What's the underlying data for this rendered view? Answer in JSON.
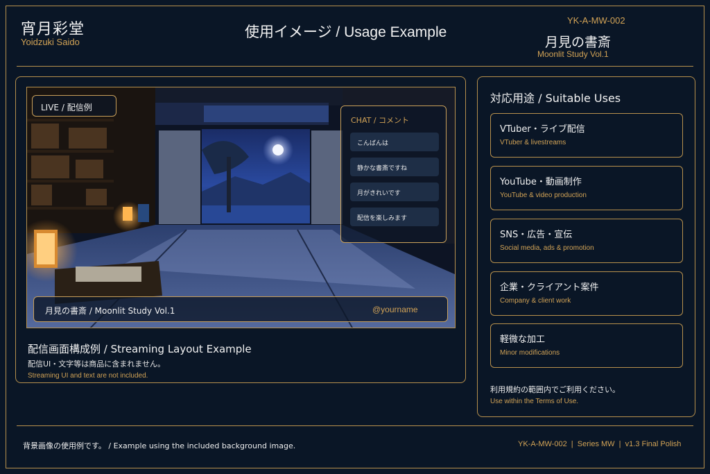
{
  "header": {
    "brand_jp": "宵月彩堂",
    "brand_en": "Yoidzuki Saido",
    "title": "使用イメージ / Usage Example",
    "product_code": "YK-A-MW-002",
    "product_jp": "月見の書斎",
    "product_en": "Moonlit Study Vol.1"
  },
  "preview": {
    "live_tag": "LIVE / 配信例",
    "chat": {
      "title": "CHAT / コメント",
      "messages": [
        "こんばんは",
        "静かな書斎ですね",
        "月がきれいです",
        "配信を楽しみます"
      ]
    },
    "bottom_bar": {
      "title": "月見の書斎 / Moonlit Study Vol.1",
      "username": "@yourname"
    }
  },
  "caption": {
    "title": "配信画面構成例 / Streaming Layout Example",
    "note_jp": "配信UI・文字等は商品に含まれません。",
    "note_en": "Streaming UI and text are not included."
  },
  "uses": {
    "title": "対応用途 / Suitable Uses",
    "items": [
      {
        "jp": "VTuber・ライブ配信",
        "en": "VTuber & livestreams"
      },
      {
        "jp": "YouTube・動画制作",
        "en": "YouTube & video production"
      },
      {
        "jp": "SNS・広告・宣伝",
        "en": "Social media, ads & promotion"
      },
      {
        "jp": "企業・クライアント案件",
        "en": "Company & client work"
      },
      {
        "jp": "軽微な加工",
        "en": "Minor modifications"
      }
    ],
    "terms_jp": "利用規約の範囲内でご利用ください。",
    "terms_en": "Use within the Terms of Use."
  },
  "footer": {
    "left": "背景画像の使用例です。 / Example using the included background image.",
    "right": "YK-A-MW-002  |  Series MW  |  v1.3 Final Polish"
  },
  "colors": {
    "background": "#0a1626",
    "accent_gold": "#b8914d",
    "text_gold": "#d2a356",
    "text_light": "#f2f2f2"
  }
}
